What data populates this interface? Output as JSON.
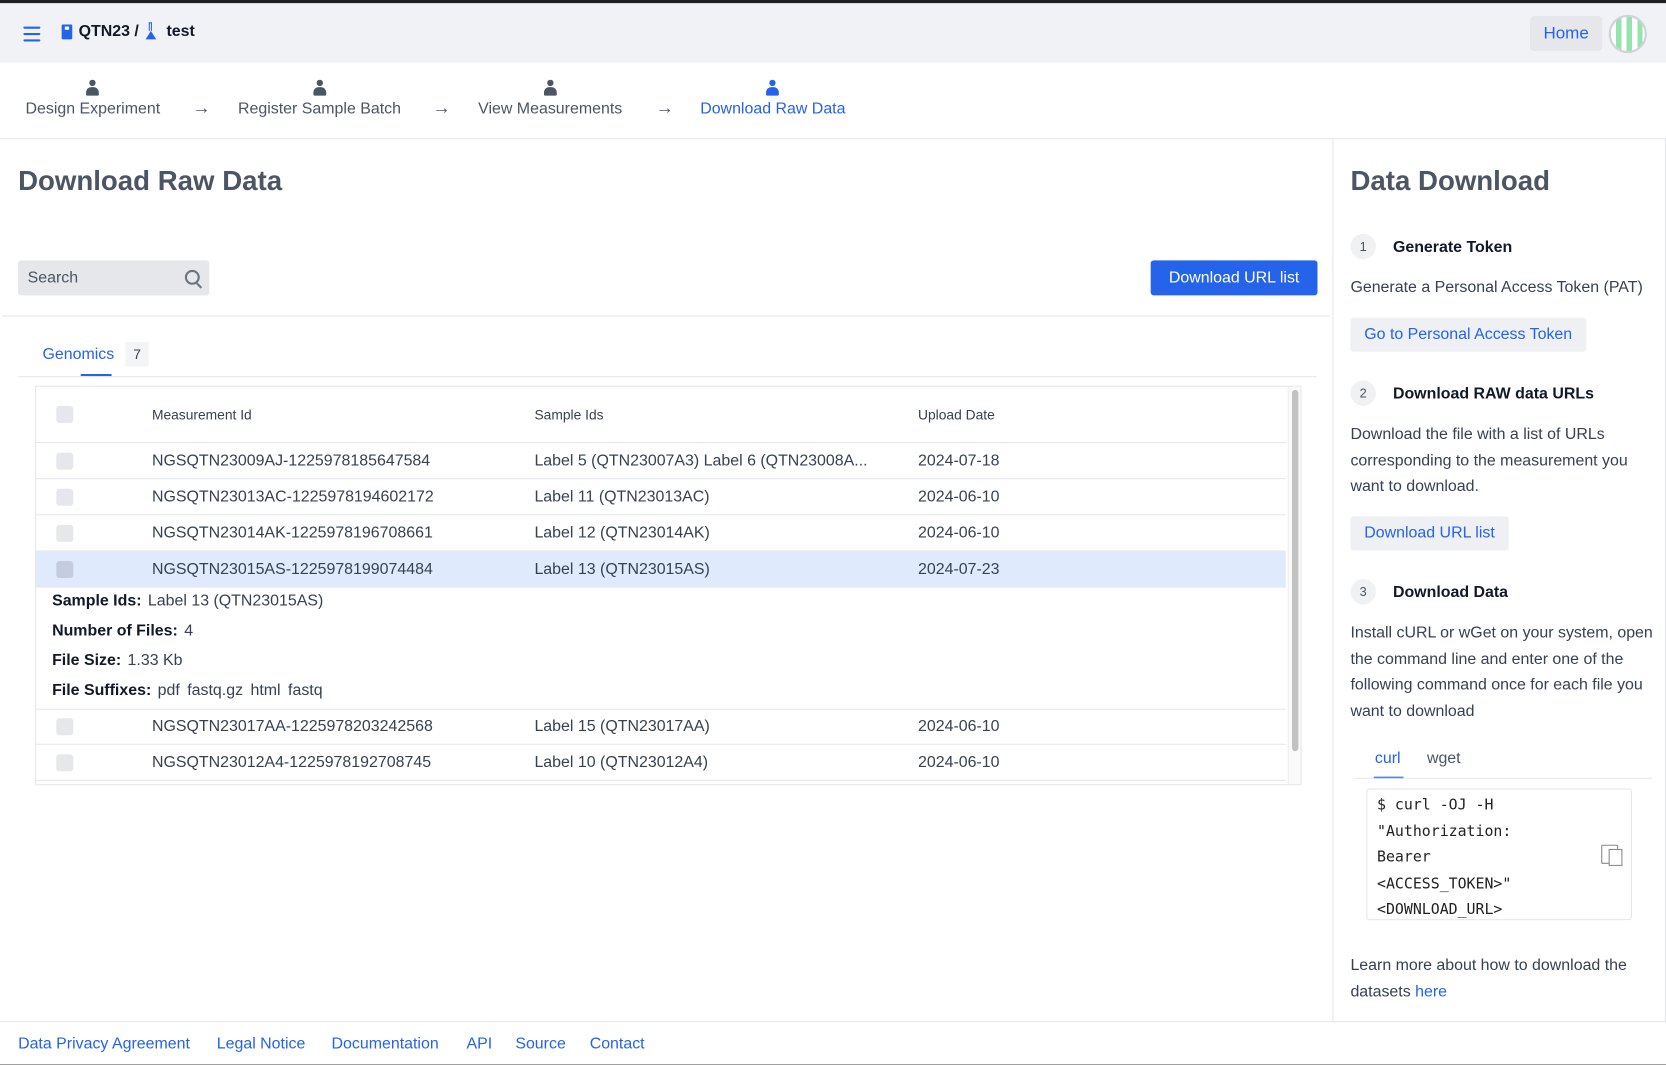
{
  "header": {
    "project": "QTN23 /",
    "experiment": "test",
    "home_label": "Home"
  },
  "steps": [
    {
      "label": "Design Experiment"
    },
    {
      "label": "Register Sample Batch"
    },
    {
      "label": "View Measurements"
    },
    {
      "label": "Download Raw Data",
      "active": true
    }
  ],
  "main": {
    "title": "Download Raw Data",
    "search_placeholder": "Search",
    "download_button": "Download URL list",
    "tab": {
      "label": "Genomics",
      "count": "7"
    },
    "columns": [
      "Measurement Id",
      "Sample Ids",
      "Upload Date"
    ],
    "rows": [
      {
        "id": "NGSQTN23009AJ-1225978185647584",
        "samples": "Label 5 (QTN23007A3) Label 6 (QTN23008A...",
        "date": "2024-07-18"
      },
      {
        "id": "NGSQTN23013AC-1225978194602172",
        "samples": "Label 11 (QTN23013AC)",
        "date": "2024-06-10"
      },
      {
        "id": "NGSQTN23014AK-1225978196708661",
        "samples": "Label 12 (QTN23014AK)",
        "date": "2024-06-10"
      },
      {
        "id": "NGSQTN23015AS-1225978199074484",
        "samples": "Label 13 (QTN23015AS)",
        "date": "2024-07-23",
        "expanded": true
      },
      {
        "id": "NGSQTN23017AA-1225978203242568",
        "samples": "Label 15 (QTN23017AA)",
        "date": "2024-06-10"
      },
      {
        "id": "NGSQTN23012A4-1225978192708745",
        "samples": "Label 10 (QTN23012A4)",
        "date": "2024-06-10"
      }
    ],
    "detail": {
      "sample_ids_label": "Sample Ids:",
      "sample_ids": "Label 13 (QTN23015AS)",
      "files_label": "Number of Files:",
      "files": "4",
      "size_label": "File Size:",
      "size": "1.33 Kb",
      "suffix_label": "File Suffixes:",
      "suffixes": [
        "pdf",
        "fastq.gz",
        "html",
        "fastq"
      ]
    }
  },
  "side": {
    "title": "Data Download",
    "step1": {
      "num": "1",
      "title": "Generate Token",
      "text": "Generate a Personal Access Token (PAT)",
      "button": "Go to Personal Access Token"
    },
    "step2": {
      "num": "2",
      "title": "Download RAW data URLs",
      "text": "Download the file with a list of URLs corresponding to the measurement you want to download.",
      "button": "Download URL list"
    },
    "step3": {
      "num": "3",
      "title": "Download Data",
      "text": "Install cURL or wGet on your system, open the command line and enter one of the following command once for each file you want to download"
    },
    "tabs": [
      "curl",
      "wget"
    ],
    "code": [
      "$ curl -OJ -H",
      "\"Authorization:",
      "Bearer",
      "<ACCESS_TOKEN>\"",
      "<DOWNLOAD_URL>"
    ],
    "learn_more": "Learn more about how to download the datasets",
    "here": "here"
  },
  "footer": [
    "Data Privacy Agreement",
    "Legal Notice",
    "Documentation",
    "API",
    "Source",
    "Contact"
  ],
  "colors": {
    "accent": "#2563eb",
    "selected_row": "#dfeafc"
  }
}
